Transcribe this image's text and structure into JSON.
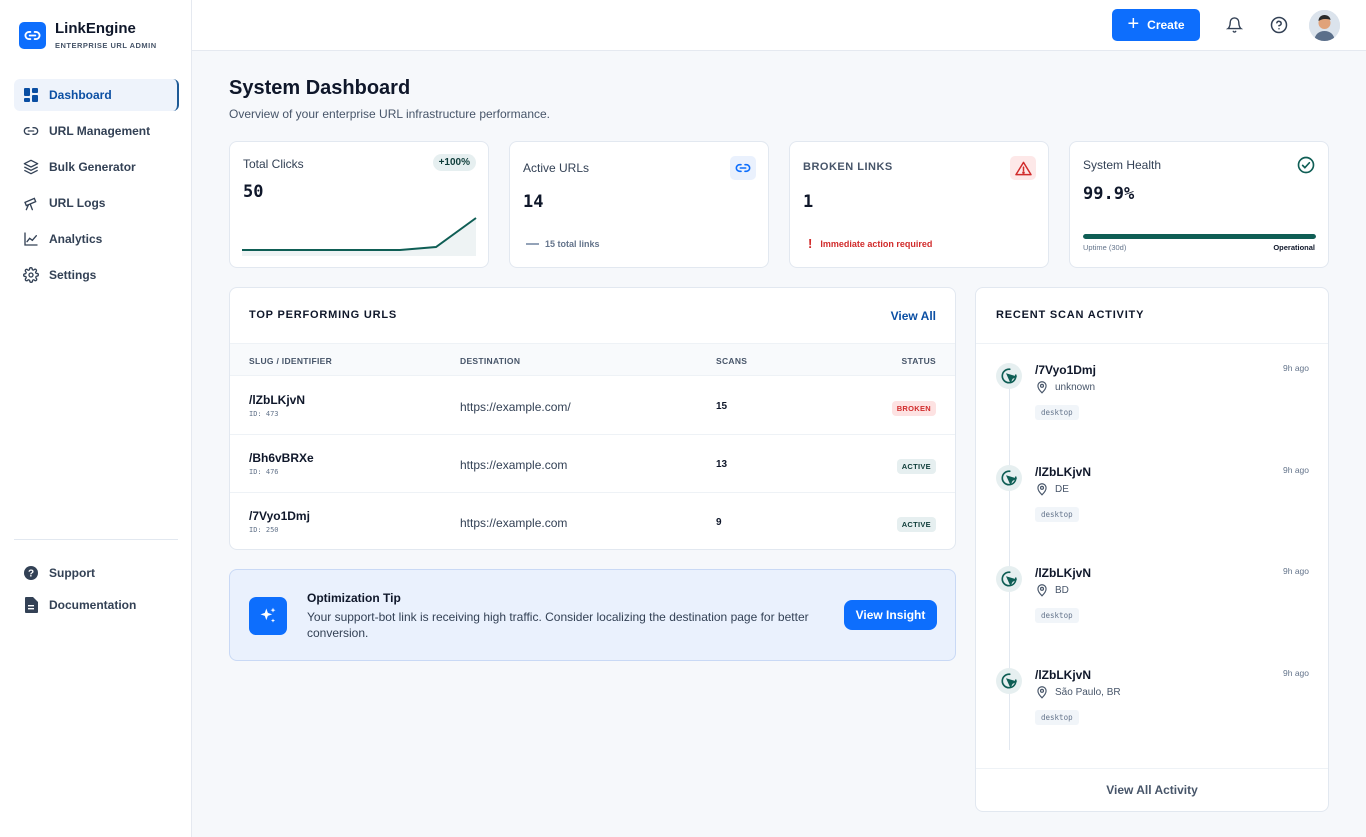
{
  "brand": {
    "title": "LinkEngine",
    "subtitle": "ENTERPRISE URL ADMIN",
    "color": "#0d6efd"
  },
  "sidebar": {
    "items": [
      {
        "label": "Dashboard",
        "icon": "dashboard-grid-icon",
        "active": true
      },
      {
        "label": "URL Management",
        "icon": "link-icon"
      },
      {
        "label": "Bulk Generator",
        "icon": "layers-icon"
      },
      {
        "label": "URL Logs",
        "icon": "telescope-icon"
      },
      {
        "label": "Analytics",
        "icon": "line-chart-icon"
      },
      {
        "label": "Settings",
        "icon": "gear-icon"
      }
    ],
    "bottom": [
      {
        "label": "Support",
        "icon": "help-circle-icon"
      },
      {
        "label": "Documentation",
        "icon": "document-icon"
      }
    ]
  },
  "topbar": {
    "create_label": "Create"
  },
  "page": {
    "title": "System Dashboard",
    "subtitle": "Overview of your enterprise URL infrastructure performance."
  },
  "stats": {
    "total_clicks": {
      "label": "Total Clicks",
      "value": "50",
      "badge": "+100%"
    },
    "active_urls": {
      "label": "Active URLs",
      "value": "14",
      "note": "15 total links"
    },
    "broken_links": {
      "label": "BROKEN LINKS",
      "value": "1",
      "note": "Immediate action required"
    },
    "system_health": {
      "label": "System Health",
      "value": "99.9%",
      "bar_fill": 1.0,
      "uptime_label": "Uptime (30d)",
      "state": "Operational"
    }
  },
  "top_urls": {
    "title": "TOP PERFORMING URLS",
    "view_all": "View All",
    "columns": [
      "SLUG / IDENTIFIER",
      "DESTINATION",
      "SCANS",
      "STATUS"
    ],
    "rows": [
      {
        "slug": "/lZbLKjvN",
        "id": "ID: 473",
        "destination": "https://example.com/",
        "scans": "15",
        "status": "BROKEN"
      },
      {
        "slug": "/Bh6vBRXe",
        "id": "ID: 476",
        "destination": "https://example.com",
        "scans": "13",
        "status": "ACTIVE"
      },
      {
        "slug": "/7Vyo1Dmj",
        "id": "ID: 250",
        "destination": "https://example.com",
        "scans": "9",
        "status": "ACTIVE"
      }
    ]
  },
  "tip": {
    "title": "Optimization Tip",
    "text": "Your support-bot link is receiving high traffic. Consider localizing the destination page for better conversion.",
    "button": "View Insight"
  },
  "activity": {
    "title": "RECENT SCAN ACTIVITY",
    "items": [
      {
        "slug": "/7Vyo1Dmj",
        "time": "9h ago",
        "location": "unknown",
        "device": "desktop"
      },
      {
        "slug": "/lZbLKjvN",
        "time": "9h ago",
        "location": "DE",
        "device": "desktop"
      },
      {
        "slug": "/lZbLKjvN",
        "time": "9h ago",
        "location": "BD",
        "device": "desktop"
      },
      {
        "slug": "/lZbLKjvN",
        "time": "9h ago",
        "location": "São Paulo, BR",
        "device": "desktop"
      }
    ],
    "footer": "View All Activity"
  },
  "colors": {
    "accent": "#0d6efd",
    "teal": "#0f5e55",
    "danger": "#d12b2b"
  }
}
